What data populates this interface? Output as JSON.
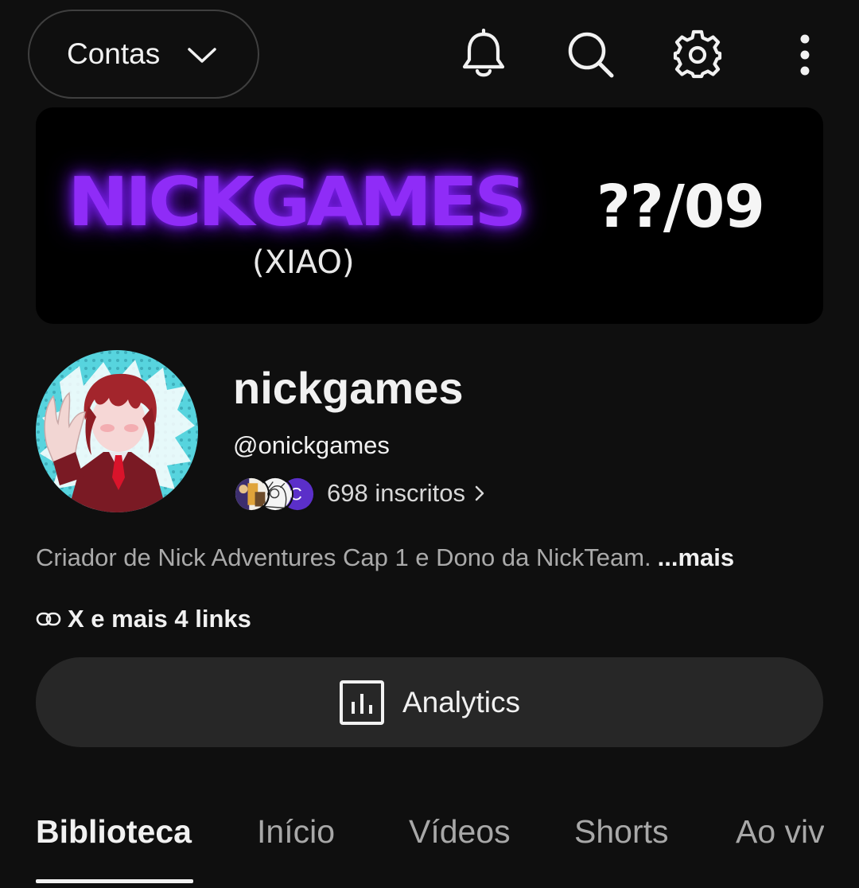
{
  "header": {
    "accounts_label": "Contas",
    "icons": [
      "notifications-bell-icon",
      "search-icon",
      "settings-gear-icon",
      "more-vertical-icon"
    ]
  },
  "banner": {
    "title": "NICKGAMES",
    "date": "??/09",
    "subtitle": "(XIAO)",
    "title_color": "#8f2cf7"
  },
  "channel": {
    "name": "nickgames",
    "handle": "@onickgames",
    "subscribers": "698 inscritos",
    "description": "Criador de Nick Adventures Cap 1 e Dono da NickTeam.",
    "more_label": "...mais",
    "links_label": "X e mais 4 links",
    "subscriber_avatar_initial": "C"
  },
  "actions": {
    "analytics_label": "Analytics"
  },
  "tabs": [
    {
      "label": "Biblioteca",
      "active": true
    },
    {
      "label": "Início",
      "active": false
    },
    {
      "label": "Vídeos",
      "active": false
    },
    {
      "label": "Shorts",
      "active": false
    },
    {
      "label": "Ao vivo",
      "active": false
    }
  ],
  "colors": {
    "background": "#0f0f0f",
    "button_bg": "#272727",
    "secondary_text": "#aaaaaa"
  }
}
